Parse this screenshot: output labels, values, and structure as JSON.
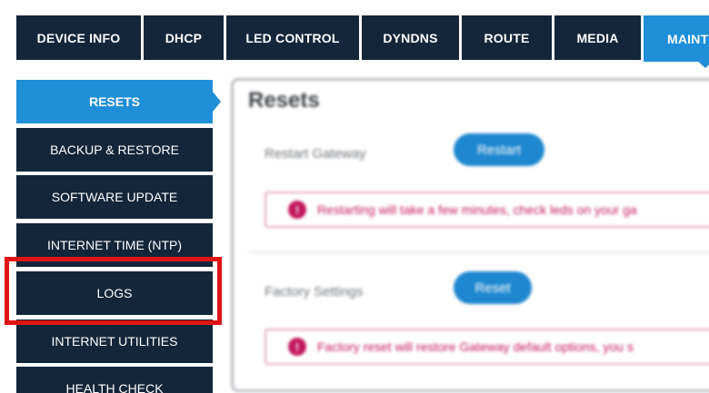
{
  "top_tabs": [
    {
      "label": "DEVICE INFO"
    },
    {
      "label": "DHCP"
    },
    {
      "label": "LED CONTROL"
    },
    {
      "label": "DYNDNS"
    },
    {
      "label": "ROUTE"
    },
    {
      "label": "MEDIA"
    },
    {
      "label": "MAINTE",
      "active": true
    }
  ],
  "side_menu": [
    {
      "label": "RESETS",
      "active": true
    },
    {
      "label": "BACKUP & RESTORE"
    },
    {
      "label": "SOFTWARE UPDATE"
    },
    {
      "label": "INTERNET TIME (NTP)"
    },
    {
      "label": "LOGS",
      "highlighted": true
    },
    {
      "label": "INTERNET UTILITIES"
    },
    {
      "label": "HEALTH CHECK"
    }
  ],
  "content": {
    "title": "Resets",
    "restart": {
      "label": "Restart Gateway",
      "button": "Restart",
      "notice": "Restarting will take a few minutes, check leds on your ga"
    },
    "factory": {
      "label": "Factory Settings",
      "button": "Reset",
      "notice": "Factory reset will restore Gateway default options, you s"
    },
    "notice_icon": "!"
  },
  "colors": {
    "nav_dark": "#13263a",
    "accent_blue": "#1e8fd8",
    "highlight_red": "#e01414",
    "notice_pink": "#c2185b"
  }
}
